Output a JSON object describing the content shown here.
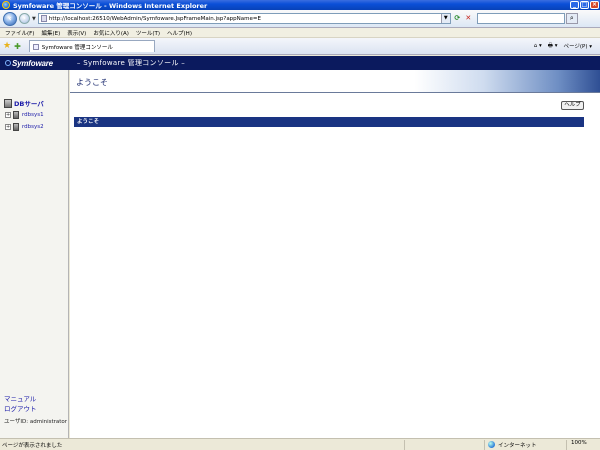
{
  "window": {
    "title": "Symfoware 管理コンソール - Windows Internet Explorer"
  },
  "address_bar": {
    "url": "http://localhost:26510/WebAdmin/Symfoware.JspFrameMain.jsp?appName=E"
  },
  "menu": {
    "items": [
      "ファイル(F)",
      "編集(E)",
      "表示(V)",
      "お気に入り(A)",
      "ツール(T)",
      "ヘルプ(H)"
    ]
  },
  "tab": {
    "label": "Symfoware 管理コンソール"
  },
  "command_bar": {
    "page_label": "ページ(P) ▾",
    "home_label": "⌂ ▾",
    "print_label": "🖶 ▾"
  },
  "app": {
    "logo": "Symfoware",
    "title": "– Symfoware 管理コンソール –"
  },
  "sidebar": {
    "root_label": "DBサーバ",
    "nodes": [
      {
        "label": "rdbsys1"
      },
      {
        "label": "rdbsys2"
      }
    ],
    "manual_link": "マニュアル",
    "logout_link": "ログアウト",
    "user_id": "ユーザID: administrator"
  },
  "main": {
    "heading": "ようこそ",
    "help_button": "ヘルプ",
    "section_title": "ようこそ"
  },
  "status": {
    "text": "ページが表示されました",
    "zone": "インターネット",
    "zoom": "100%"
  }
}
